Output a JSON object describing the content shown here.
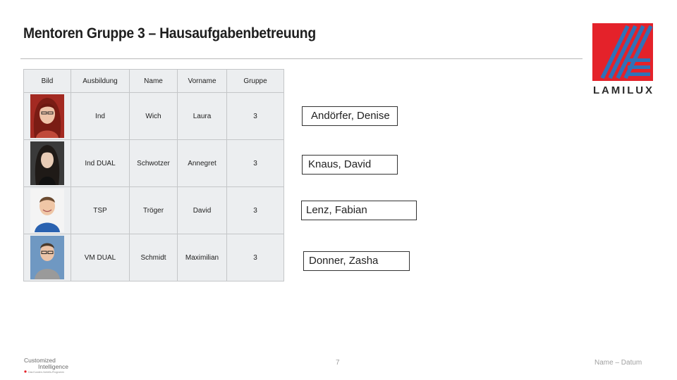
{
  "slide": {
    "title": "Mentoren Gruppe 3 – Hausaufgabenbetreuung",
    "page_number": "7",
    "footer_right": "Name – Datum"
  },
  "logo": {
    "text": "LAMILUX",
    "colors": {
      "red": "#e4222a",
      "blue": "#2f72b8",
      "dark": "#2b2b2b"
    }
  },
  "footer_logo": {
    "line1": "Customized",
    "line2": "Intelligence",
    "tagline": "Das Kunden-Vorteils-Programm"
  },
  "table": {
    "headers": [
      "Bild",
      "Ausbildung",
      "Name",
      "Vorname",
      "Gruppe"
    ],
    "rows": [
      {
        "ausbildung": "Ind",
        "name": "Wich",
        "vorname": "Laura",
        "gruppe": "3"
      },
      {
        "ausbildung": "Ind DUAL",
        "name": "Schwotzer",
        "vorname": "Annegret",
        "gruppe": "3"
      },
      {
        "ausbildung": "TSP",
        "name": "Tröger",
        "vorname": "David",
        "gruppe": "3"
      },
      {
        "ausbildung": "VM DUAL",
        "name": "Schmidt",
        "vorname": "Maximilian",
        "gruppe": "3"
      }
    ]
  },
  "mentees": [
    "Andörfer, Denise",
    "Knaus, David",
    "Lenz, Fabian",
    "Donner, Zasha"
  ]
}
